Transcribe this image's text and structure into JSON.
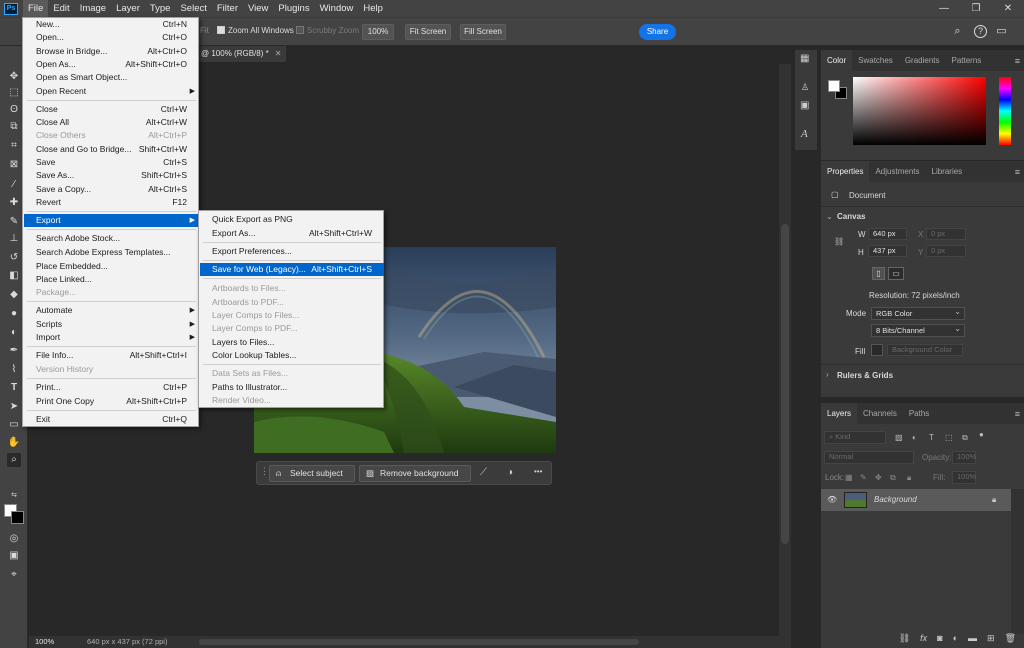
{
  "menubar": {
    "logo": "Ps",
    "items": [
      "File",
      "Edit",
      "Image",
      "Layer",
      "Type",
      "Select",
      "Filter",
      "View",
      "Plugins",
      "Window",
      "Help"
    ]
  },
  "options": {
    "fit_label": "Fit",
    "zoom_all_windows": "Zoom All Windows",
    "scrubby_zoom": "Scrubby Zoom",
    "zoom_value": "100%",
    "fit_screen": "Fit Screen",
    "fill_screen": "Fill Screen",
    "share": "Share"
  },
  "document": {
    "tab_label": "@ 100% (RGB/8) *",
    "status_zoom": "100%",
    "status_info": "640 px x 437 px (72 ppi)"
  },
  "context_bar": {
    "select_subject": "Select subject",
    "remove_background": "Remove background",
    "more": "•••"
  },
  "file_menu": {
    "items": [
      {
        "label": "New...",
        "shortcut": "Ctrl+N"
      },
      {
        "label": "Open...",
        "shortcut": "Ctrl+O"
      },
      {
        "label": "Browse in Bridge...",
        "shortcut": "Alt+Ctrl+O"
      },
      {
        "label": "Open As...",
        "shortcut": "Alt+Shift+Ctrl+O"
      },
      {
        "label": "Open as Smart Object...",
        "shortcut": ""
      },
      {
        "label": "Open Recent",
        "shortcut": ""
      },
      {
        "label": "Close",
        "shortcut": "Ctrl+W"
      },
      {
        "label": "Close All",
        "shortcut": "Alt+Ctrl+W"
      },
      {
        "label": "Close Others",
        "shortcut": "Alt+Ctrl+P"
      },
      {
        "label": "Close and Go to Bridge...",
        "shortcut": "Shift+Ctrl+W"
      },
      {
        "label": "Save",
        "shortcut": "Ctrl+S"
      },
      {
        "label": "Save As...",
        "shortcut": "Shift+Ctrl+S"
      },
      {
        "label": "Save a Copy...",
        "shortcut": "Alt+Ctrl+S"
      },
      {
        "label": "Revert",
        "shortcut": "F12"
      },
      {
        "label": "Export",
        "shortcut": ""
      },
      {
        "label": "Search Adobe Stock...",
        "shortcut": ""
      },
      {
        "label": "Search Adobe Express Templates...",
        "shortcut": ""
      },
      {
        "label": "Place Embedded...",
        "shortcut": ""
      },
      {
        "label": "Place Linked...",
        "shortcut": ""
      },
      {
        "label": "Package...",
        "shortcut": ""
      },
      {
        "label": "Automate",
        "shortcut": ""
      },
      {
        "label": "Scripts",
        "shortcut": ""
      },
      {
        "label": "Import",
        "shortcut": ""
      },
      {
        "label": "File Info...",
        "shortcut": "Alt+Shift+Ctrl+I"
      },
      {
        "label": "Version History",
        "shortcut": ""
      },
      {
        "label": "Print...",
        "shortcut": "Ctrl+P"
      },
      {
        "label": "Print One Copy",
        "shortcut": "Alt+Shift+Ctrl+P"
      },
      {
        "label": "Exit",
        "shortcut": "Ctrl+Q"
      }
    ]
  },
  "export_menu": {
    "items": [
      {
        "label": "Quick Export as PNG",
        "shortcut": ""
      },
      {
        "label": "Export As...",
        "shortcut": "Alt+Shift+Ctrl+W"
      },
      {
        "label": "Export Preferences...",
        "shortcut": ""
      },
      {
        "label": "Save for Web (Legacy)...",
        "shortcut": "Alt+Shift+Ctrl+S"
      },
      {
        "label": "Artboards to Files...",
        "shortcut": ""
      },
      {
        "label": "Artboards to PDF...",
        "shortcut": ""
      },
      {
        "label": "Layer Comps to Files...",
        "shortcut": ""
      },
      {
        "label": "Layer Comps to PDF...",
        "shortcut": ""
      },
      {
        "label": "Layers to Files...",
        "shortcut": ""
      },
      {
        "label": "Color Lookup Tables...",
        "shortcut": ""
      },
      {
        "label": "Data Sets as Files...",
        "shortcut": ""
      },
      {
        "label": "Paths to Illustrator...",
        "shortcut": ""
      },
      {
        "label": "Render Video...",
        "shortcut": ""
      }
    ]
  },
  "color_panel": {
    "tabs": [
      "Color",
      "Swatches",
      "Gradients",
      "Patterns"
    ],
    "hue_color": "#ff0000"
  },
  "properties_panel": {
    "tabs": [
      "Properties",
      "Adjustments",
      "Libraries"
    ],
    "type": "Document",
    "canvas_title": "Canvas",
    "w_label": "W",
    "w_value": "640 px",
    "h_label": "H",
    "h_value": "437 px",
    "x_label": "X",
    "x_placeholder": "0 px",
    "y_label": "Y",
    "y_placeholder": "0 px",
    "resolution": "Resolution: 72 pixels/inch",
    "mode_label": "Mode",
    "mode_value": "RGB Color",
    "bits_value": "8 Bits/Channel",
    "fill_label": "Fill",
    "fill_value": "Background Color",
    "rulers_grids": "Rulers & Grids"
  },
  "layers_panel": {
    "tabs": [
      "Layers",
      "Channels",
      "Paths"
    ],
    "kind_placeholder": "Kind",
    "blend_mode": "Normal",
    "opacity_label": "Opacity:",
    "opacity_value": "100%",
    "lock_label": "Lock:",
    "fill_label": "Fill:",
    "fill_value": "100%",
    "layer_name": "Background"
  }
}
